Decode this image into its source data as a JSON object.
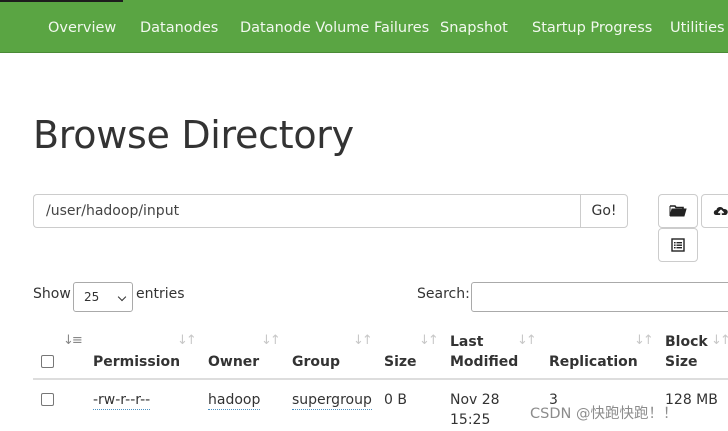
{
  "navbar": {
    "items": [
      {
        "label": "Overview"
      },
      {
        "label": "Datanodes"
      },
      {
        "label": "Datanode Volume Failures"
      },
      {
        "label": "Snapshot"
      },
      {
        "label": "Startup Progress"
      },
      {
        "label": "Utilities"
      }
    ]
  },
  "page": {
    "title": "Browse Directory"
  },
  "path_bar": {
    "value": "/user/hadoop/input",
    "go_label": "Go!"
  },
  "toolbar": {
    "icons": [
      "folder-open-icon",
      "cloud-upload-icon",
      "list-alt-icon"
    ]
  },
  "table_controls": {
    "show_label": "Show",
    "page_size": "25",
    "entries_label": "entries",
    "search_label": "Search:",
    "search_value": ""
  },
  "table": {
    "columns": [
      "Permission",
      "Owner",
      "Group",
      "Size",
      "Last",
      "Modified",
      "Replication",
      "Block",
      "Size"
    ],
    "rows": [
      {
        "permission": "-rw-r--r--",
        "owner": "hadoop",
        "group": "supergroup",
        "size": "0 B",
        "modified_date": "Nov 28",
        "modified_time": "15:25",
        "replication": "3",
        "block_size": "128 MB"
      }
    ]
  },
  "watermark": "CSDN @快跑快跑！！"
}
